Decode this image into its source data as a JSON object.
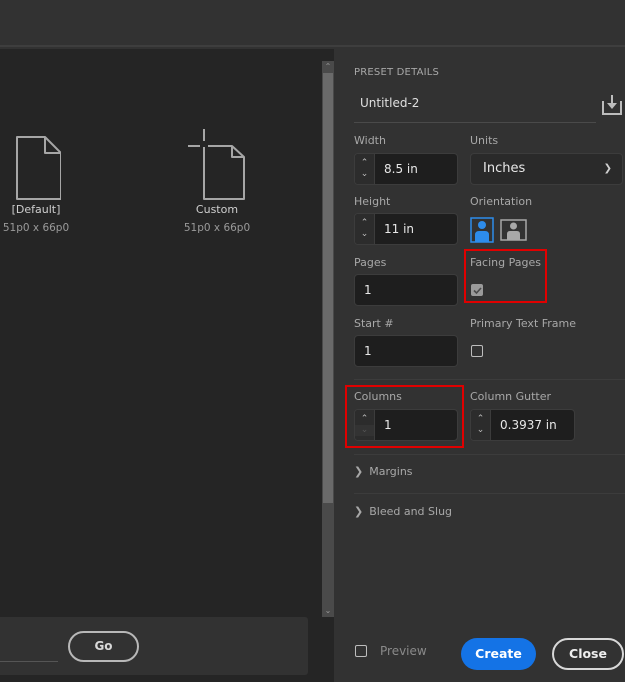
{
  "presets": [
    {
      "name": "[Default]",
      "size": "51p0 x 66p0",
      "icon": "blank-document-icon"
    },
    {
      "name": "Custom",
      "size": "51p0 x 66p0",
      "icon": "custom-document-icon"
    }
  ],
  "search": {
    "go_label": "Go"
  },
  "details": {
    "section_title": "PRESET DETAILS",
    "document_name": "Untitled-2",
    "save_preset_icon": "save-preset-icon",
    "width": {
      "label": "Width",
      "value": "8.5 in"
    },
    "units": {
      "label": "Units",
      "value": "Inches"
    },
    "height": {
      "label": "Height",
      "value": "11 in"
    },
    "orientation": {
      "label": "Orientation",
      "selected": "portrait",
      "options": [
        "portrait",
        "landscape"
      ]
    },
    "pages": {
      "label": "Pages",
      "value": "1"
    },
    "facing_pages": {
      "label": "Facing Pages",
      "checked": true,
      "disabled": true
    },
    "start_number": {
      "label": "Start #",
      "value": "1"
    },
    "primary_text_frame": {
      "label": "Primary Text Frame",
      "checked": false
    },
    "columns": {
      "label": "Columns",
      "value": "1"
    },
    "column_gutter": {
      "label": "Column Gutter",
      "value": "0.3937 in"
    },
    "margins_label": "Margins",
    "bleed_slug_label": "Bleed and Slug"
  },
  "footer": {
    "preview_label": "Preview",
    "preview_checked": false,
    "create_label": "Create",
    "close_label": "Close"
  },
  "colors": {
    "accent": "#1473e6",
    "highlight": "#e00000",
    "panel_bg": "#323232",
    "content_bg": "#252525"
  }
}
